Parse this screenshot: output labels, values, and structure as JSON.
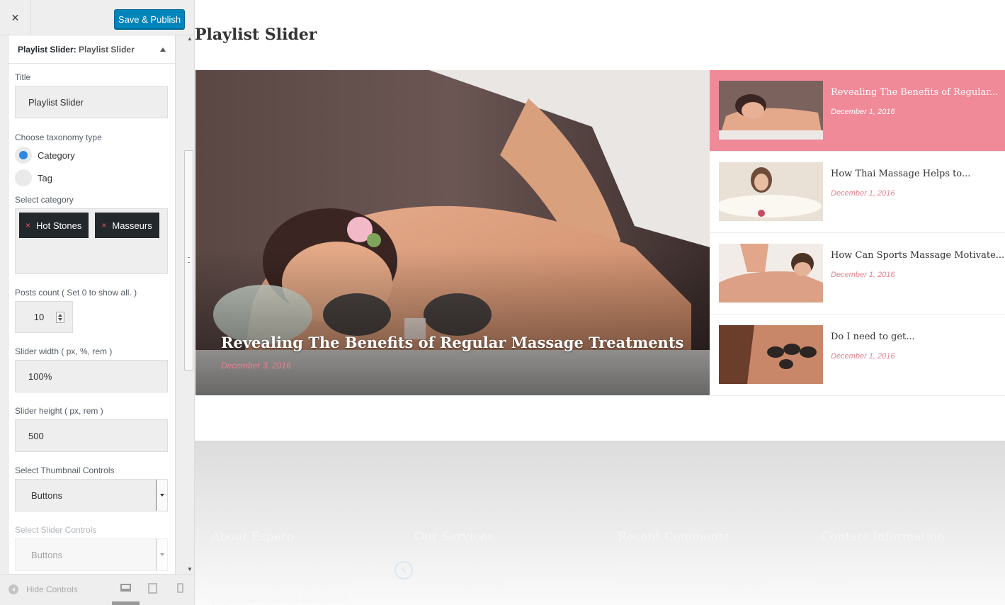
{
  "topbar": {
    "close_label": "×",
    "publish_label": "Save & Publish"
  },
  "panel": {
    "head_prefix": "Playlist Slider:",
    "head_name": "Playlist Slider",
    "fields": {
      "title_label": "Title",
      "title_value": "Playlist Slider",
      "taxonomy_label": "Choose taxonomy type",
      "taxonomy_options": [
        "Category",
        "Tag"
      ],
      "taxonomy_selected": "Category",
      "category_label": "Select category",
      "categories": [
        "Hot Stones",
        "Masseurs"
      ],
      "chip_remove": "×",
      "posts_label": "Posts count ( Set 0 to show all. )",
      "posts_value": "10",
      "width_label": "Slider width ( px, %, rem )",
      "width_value": "100%",
      "height_label": "Slider height ( px, rem )",
      "height_value": "500",
      "thumb_controls_label": "Select Thumbnail Controls",
      "thumb_controls_value": "Buttons",
      "slider_controls_label": "Select Slider Controls",
      "slider_controls_value": "Buttons"
    }
  },
  "footer_controls": {
    "hide_label": "Hide Controls"
  },
  "preview": {
    "widget_title": "Playlist Slider",
    "main_slide": {
      "title": "Revealing The Benefits of Regular Massage Treatments",
      "date": "December 3, 2016"
    },
    "thumbs": [
      {
        "title": "Revealing The Benefits of Regular...",
        "date": "December 1, 2016",
        "active": true
      },
      {
        "title": "How Thai Massage Helps to...",
        "date": "December 1, 2016",
        "active": false
      },
      {
        "title": "How Can Sports Massage Motivate...",
        "date": "December 1, 2016",
        "active": false
      },
      {
        "title": "Do I need to get...",
        "date": "December 1, 2016",
        "active": false
      }
    ],
    "footer": {
      "about_title": "About Espero",
      "about_text": "Our mission at Espero is to provide you with the ultimate salon/spa experience in a gorgeous and peaceful environment.",
      "services_title": "Our Services",
      "services_items": [
        "Pre & Post Natal Massages",
        "Aromatherapy Massage"
      ],
      "comments_title": "Recent Comments",
      "comments_items": [
        "admin on",
        "Revealing The Benefits of Regular Mas..."
      ],
      "contact_title": "Contact Information",
      "contact_text": "Address: 4578 Marmora Road, Glasgow D04 89GR"
    }
  },
  "colors": {
    "accent_pink": "#f08a98",
    "publish_blue": "#0085ba",
    "chip_dark": "#23282d",
    "radio_blue": "#2e86de"
  }
}
